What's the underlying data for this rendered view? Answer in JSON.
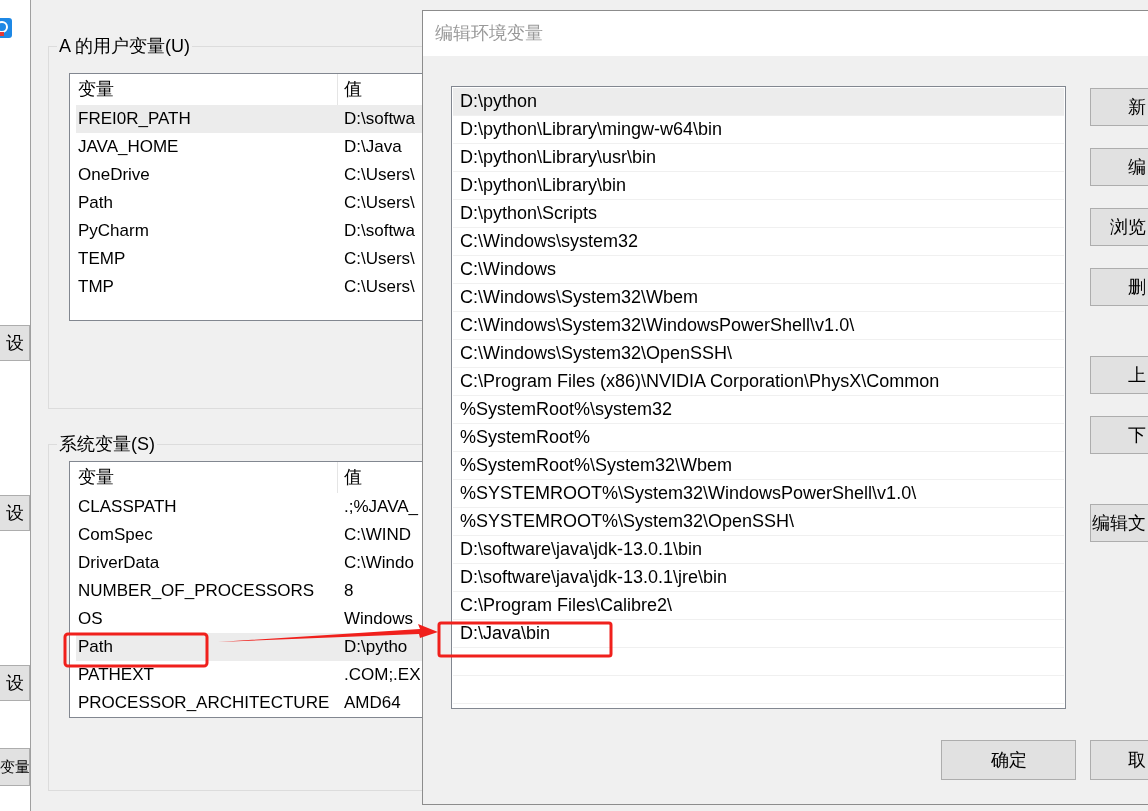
{
  "background_app": {
    "buttons": [
      "设",
      "设",
      "设"
    ],
    "bottom_button": "变量"
  },
  "env_dialog": {
    "groups": [
      {
        "title": "A 的用户变量(U)",
        "columns": [
          "变量",
          "值"
        ],
        "rows": [
          {
            "name": "FREI0R_PATH",
            "value": "D:\\softwa",
            "selected": true
          },
          {
            "name": "JAVA_HOME",
            "value": "D:\\Java",
            "selected": false
          },
          {
            "name": "OneDrive",
            "value": "C:\\Users\\",
            "selected": false
          },
          {
            "name": "Path",
            "value": "C:\\Users\\",
            "selected": false
          },
          {
            "name": "PyCharm",
            "value": "D:\\softwa",
            "selected": false
          },
          {
            "name": "TEMP",
            "value": "C:\\Users\\",
            "selected": false
          },
          {
            "name": "TMP",
            "value": "C:\\Users\\",
            "selected": false
          }
        ]
      },
      {
        "title": "系统变量(S)",
        "columns": [
          "变量",
          "值"
        ],
        "rows": [
          {
            "name": "CLASSPATH",
            "value": ".;%JAVA_",
            "selected": false
          },
          {
            "name": "ComSpec",
            "value": "C:\\WIND",
            "selected": false
          },
          {
            "name": "DriverData",
            "value": "C:\\Windo",
            "selected": false
          },
          {
            "name": "NUMBER_OF_PROCESSORS",
            "value": "8",
            "selected": false
          },
          {
            "name": "OS",
            "value": "Windows",
            "selected": false
          },
          {
            "name": "Path",
            "value": "D:\\pytho",
            "selected": true
          },
          {
            "name": "PATHEXT",
            "value": ".COM;.EX",
            "selected": false
          },
          {
            "name": "PROCESSOR_ARCHITECTURE",
            "value": "AMD64",
            "selected": false
          }
        ]
      }
    ]
  },
  "edit_dialog": {
    "title": "编辑环境变量",
    "entries": [
      {
        "text": "D:\\python",
        "selected": true
      },
      {
        "text": "D:\\python\\Library\\mingw-w64\\bin",
        "selected": false
      },
      {
        "text": "D:\\python\\Library\\usr\\bin",
        "selected": false
      },
      {
        "text": "D:\\python\\Library\\bin",
        "selected": false
      },
      {
        "text": "D:\\python\\Scripts",
        "selected": false
      },
      {
        "text": "C:\\Windows\\system32",
        "selected": false
      },
      {
        "text": "C:\\Windows",
        "selected": false
      },
      {
        "text": "C:\\Windows\\System32\\Wbem",
        "selected": false
      },
      {
        "text": "C:\\Windows\\System32\\WindowsPowerShell\\v1.0\\",
        "selected": false
      },
      {
        "text": "C:\\Windows\\System32\\OpenSSH\\",
        "selected": false
      },
      {
        "text": "C:\\Program Files (x86)\\NVIDIA Corporation\\PhysX\\Common",
        "selected": false
      },
      {
        "text": "%SystemRoot%\\system32",
        "selected": false
      },
      {
        "text": "%SystemRoot%",
        "selected": false
      },
      {
        "text": "%SystemRoot%\\System32\\Wbem",
        "selected": false
      },
      {
        "text": "%SYSTEMROOT%\\System32\\WindowsPowerShell\\v1.0\\",
        "selected": false
      },
      {
        "text": "%SYSTEMROOT%\\System32\\OpenSSH\\",
        "selected": false
      },
      {
        "text": "D:\\software\\java\\jdk-13.0.1\\bin",
        "selected": false
      },
      {
        "text": "D:\\software\\java\\jdk-13.0.1\\jre\\bin",
        "selected": false
      },
      {
        "text": "C:\\Program Files\\Calibre2\\",
        "selected": false
      },
      {
        "text": "D:\\Java\\bin",
        "selected": false
      }
    ],
    "side_button_groups": [
      [
        "新",
        "编",
        "浏览",
        "删"
      ],
      [
        "上",
        "下"
      ],
      [
        "编辑文"
      ]
    ],
    "footer_buttons": [
      "确定",
      "取"
    ]
  }
}
